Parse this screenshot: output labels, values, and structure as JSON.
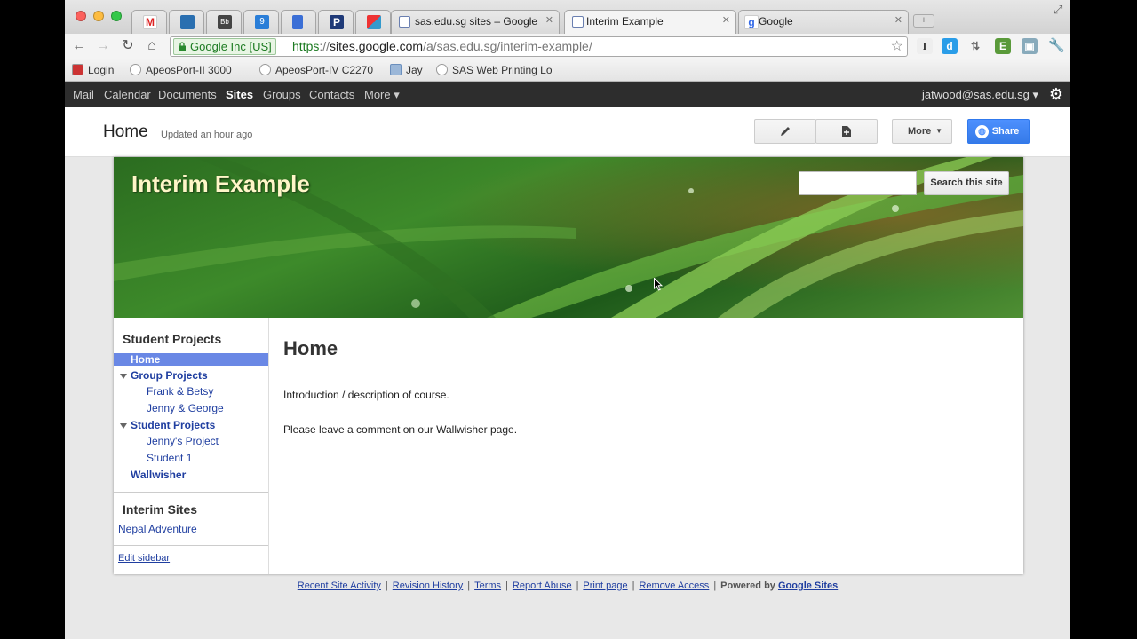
{
  "tabs": [
    {
      "title": "",
      "icon": "gmail-icon"
    },
    {
      "title": "",
      "icon": "bird-icon"
    },
    {
      "title": "",
      "icon": "bb-icon"
    },
    {
      "title": "",
      "icon": "9-icon"
    },
    {
      "title": "",
      "icon": "docs-icon"
    },
    {
      "title": "",
      "icon": "p-icon"
    },
    {
      "title": "",
      "icon": "apps-icon"
    },
    {
      "title": "sas.edu.sg sites – Google Sit",
      "icon": "sites-icon"
    },
    {
      "title": "Interim Example",
      "icon": "sites-icon",
      "active": true
    },
    {
      "title": "Google",
      "icon": "google-icon"
    }
  ],
  "toolbar": {
    "ev_cert": "Google Inc [US]",
    "url_scheme": "https",
    "url_sep": "://",
    "url_domain": "sites.google.com",
    "url_path": "/a/sas.edu.sg/interim-example/"
  },
  "bookmarks": [
    "Login",
    "ApeosPort-II 3000",
    "ApeosPort-IV C2270",
    "Jay",
    "SAS Web Printing Lo"
  ],
  "gbar": {
    "links": [
      "Mail",
      "Calendar",
      "Documents",
      "Sites",
      "Groups",
      "Contacts",
      "More ▾"
    ],
    "account": "jatwood@sas.edu.sg ▾"
  },
  "header": {
    "title": "Home",
    "updated": "Updated an hour ago",
    "more_label": "More",
    "share_label": "Share"
  },
  "site": {
    "name": "Interim Example",
    "search_label": "Search this site",
    "search_value": ""
  },
  "sidebar": {
    "heading1": "Student Projects",
    "items": [
      {
        "label": "Home",
        "level": 0,
        "bold": true
      },
      {
        "label": "Group Projects",
        "level": 0,
        "bold": true
      },
      {
        "label": "Frank & Betsy",
        "level": 1
      },
      {
        "label": "Jenny & George",
        "level": 1
      },
      {
        "label": "Student Projects",
        "level": 0,
        "bold": true
      },
      {
        "label": "Jenny's Project",
        "level": 1
      },
      {
        "label": "Student 1",
        "level": 1
      },
      {
        "label": "Wallwisher",
        "level": 0,
        "bold": true
      }
    ],
    "heading2": "Interim Sites",
    "link2": "Nepal Adventure",
    "edit": "Edit sidebar"
  },
  "content": {
    "title": "Home",
    "p1": "Introduction / description of course.",
    "p2": "Please leave a comment on our Wallwisher page."
  },
  "footer": {
    "links": [
      "Recent Site Activity",
      "Revision History",
      "Terms",
      "Report Abuse",
      "Print page",
      "Remove Access"
    ],
    "powered": "Powered by",
    "powered_link": "Google Sites"
  },
  "colors": {
    "share_blue": "#4d90fe",
    "nav_highlight": "#6a88e5",
    "link": "#1f3ea0",
    "gbar": "#2d2d2d"
  }
}
